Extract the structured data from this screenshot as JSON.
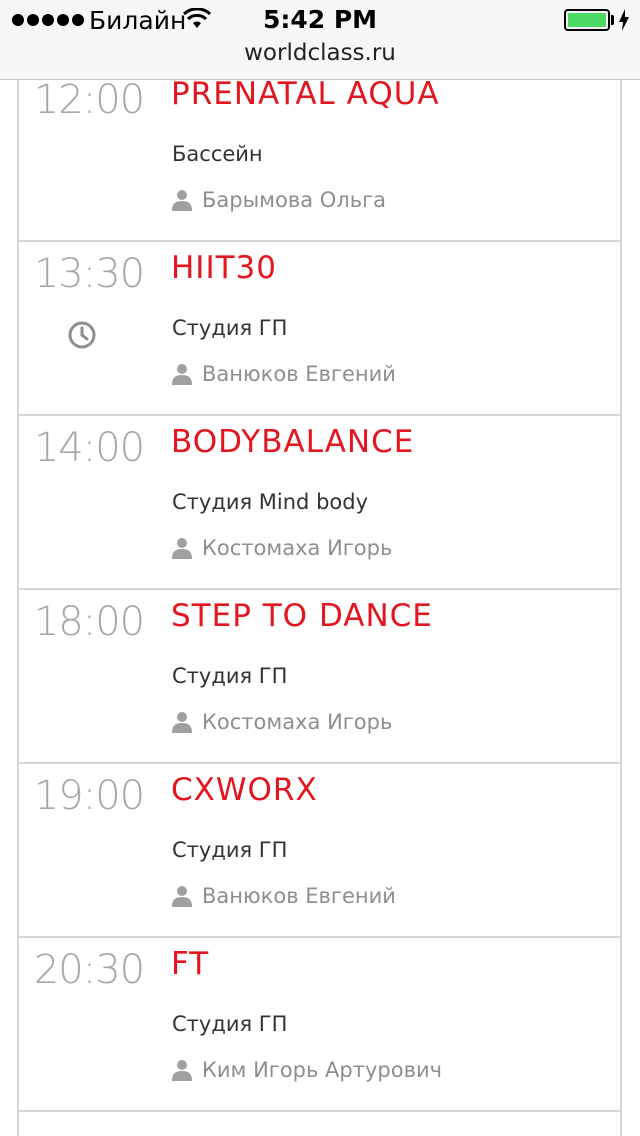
{
  "status_bar": {
    "carrier": "Билайн",
    "time": "5:42 PM",
    "battery_color": "#4cd964"
  },
  "browser": {
    "url": "worldclass.ru"
  },
  "accent_color": "#e3161f",
  "schedule": [
    {
      "time": "12:00",
      "title": "PRENATAL AQUA",
      "room": "Бассейн",
      "trainer": "Барымова Ольга"
    },
    {
      "time": "13:30",
      "title": "HIIT30",
      "room": "Студия ГП",
      "trainer": "Ванюков Евгений",
      "icon": "clock-icon"
    },
    {
      "time": "14:00",
      "title": "BODYBALANCE",
      "room": "Студия Mind body",
      "trainer": "Костомаха Игорь"
    },
    {
      "time": "18:00",
      "title": "STEP TO DANCE",
      "room": "Студия ГП",
      "trainer": "Костомаха Игорь"
    },
    {
      "time": "19:00",
      "title": "CXWORX",
      "room": "Студия ГП",
      "trainer": "Ванюков Евгений"
    },
    {
      "time": "20:30",
      "title": "FT",
      "room": "Студия ГП",
      "trainer": "Ким Игорь Артурович"
    }
  ]
}
